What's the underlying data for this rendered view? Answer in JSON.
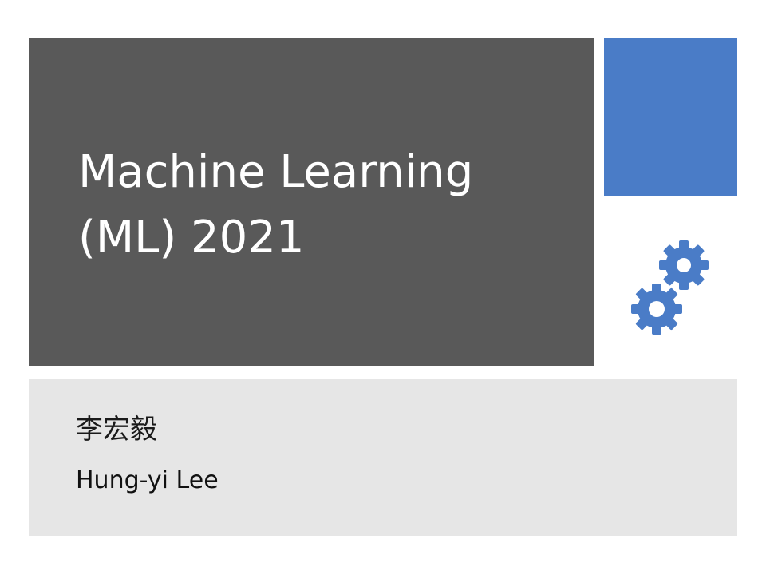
{
  "slide": {
    "title_lines": [
      "Machine Learning",
      "(ML) 2021"
    ],
    "author_chinese": "李宏毅",
    "author_english": "Hung-yi Lee"
  },
  "decoration": {
    "icon": "gears-icon",
    "colors": {
      "title_panel": "#595959",
      "accent": "#4a7cc7",
      "subtitle_panel": "#e6e6e6",
      "title_text": "#ffffff"
    }
  }
}
